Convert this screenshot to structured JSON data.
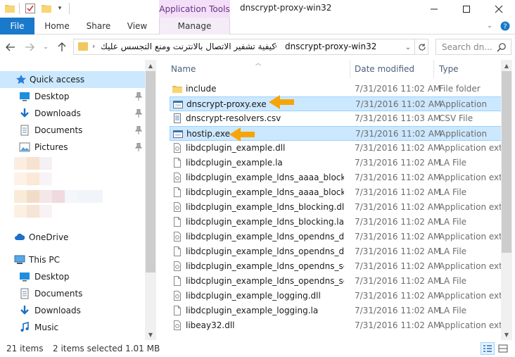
{
  "window": {
    "title": "dnscrypt-proxy-win32",
    "context_tab": "Application Tools"
  },
  "ribbon": {
    "tabs": [
      "File",
      "Home",
      "Share",
      "View",
      "Manage"
    ]
  },
  "address": {
    "crumbs": [
      "كيفية تشفير الاتصال بالانترنت ومنع التجسس عليك",
      "dnscrypt-proxy-win32"
    ],
    "search_placeholder": "Search dn..."
  },
  "nav": {
    "quick_access": "Quick access",
    "quick_items": [
      {
        "label": "Desktop",
        "icon": "desktop-icon",
        "pinned": true
      },
      {
        "label": "Downloads",
        "icon": "downloads-icon",
        "pinned": true
      },
      {
        "label": "Documents",
        "icon": "documents-icon",
        "pinned": true
      },
      {
        "label": "Pictures",
        "icon": "pictures-icon",
        "pinned": true
      }
    ],
    "onedrive": "OneDrive",
    "this_pc": "This PC",
    "pc_items": [
      {
        "label": "Desktop",
        "icon": "desktop-icon"
      },
      {
        "label": "Documents",
        "icon": "documents-icon"
      },
      {
        "label": "Downloads",
        "icon": "downloads-icon"
      },
      {
        "label": "Music",
        "icon": "music-icon"
      }
    ]
  },
  "columns": {
    "name": "Name",
    "date": "Date modified",
    "type": "Type"
  },
  "files": [
    {
      "name": "include",
      "date": "7/31/2016 11:02 AM",
      "type": "File folder",
      "icon": "folder-icon",
      "selected": false
    },
    {
      "name": "dnscrypt-proxy.exe",
      "date": "7/31/2016 11:02 AM",
      "type": "Application",
      "icon": "exe-icon",
      "selected": true
    },
    {
      "name": "dnscrypt-resolvers.csv",
      "date": "7/31/2016 11:03 AM",
      "type": "CSV File",
      "icon": "csv-icon",
      "selected": false
    },
    {
      "name": "hostip.exe",
      "date": "7/31/2016 11:02 AM",
      "type": "Application",
      "icon": "exe-icon",
      "selected": true
    },
    {
      "name": "libdcplugin_example.dll",
      "date": "7/31/2016 11:02 AM",
      "type": "Application exten",
      "icon": "dll-icon",
      "selected": false
    },
    {
      "name": "libdcplugin_example.la",
      "date": "7/31/2016 11:02 AM",
      "type": "LA File",
      "icon": "file-icon",
      "selected": false
    },
    {
      "name": "libdcplugin_example_ldns_aaaa_blocking....",
      "date": "7/31/2016 11:02 AM",
      "type": "Application exten",
      "icon": "dll-icon",
      "selected": false
    },
    {
      "name": "libdcplugin_example_ldns_aaaa_blocking....",
      "date": "7/31/2016 11:02 AM",
      "type": "LA File",
      "icon": "file-icon",
      "selected": false
    },
    {
      "name": "libdcplugin_example_ldns_blocking.dll",
      "date": "7/31/2016 11:02 AM",
      "type": "Application exten",
      "icon": "dll-icon",
      "selected": false
    },
    {
      "name": "libdcplugin_example_ldns_blocking.la",
      "date": "7/31/2016 11:02 AM",
      "type": "LA File",
      "icon": "file-icon",
      "selected": false
    },
    {
      "name": "libdcplugin_example_ldns_opendns_devi...",
      "date": "7/31/2016 11:02 AM",
      "type": "Application exten",
      "icon": "dll-icon",
      "selected": false
    },
    {
      "name": "libdcplugin_example_ldns_opendns_devi...",
      "date": "7/31/2016 11:02 AM",
      "type": "LA File",
      "icon": "file-icon",
      "selected": false
    },
    {
      "name": "libdcplugin_example_ldns_opendns_set_...",
      "date": "7/31/2016 11:02 AM",
      "type": "Application exten",
      "icon": "dll-icon",
      "selected": false
    },
    {
      "name": "libdcplugin_example_ldns_opendns_set_...",
      "date": "7/31/2016 11:02 AM",
      "type": "LA File",
      "icon": "file-icon",
      "selected": false
    },
    {
      "name": "libdcplugin_example_logging.dll",
      "date": "7/31/2016 11:02 AM",
      "type": "Application exten",
      "icon": "dll-icon",
      "selected": false
    },
    {
      "name": "libdcplugin_example_logging.la",
      "date": "7/31/2016 11:02 AM",
      "type": "LA File",
      "icon": "file-icon",
      "selected": false
    },
    {
      "name": "libeay32.dll",
      "date": "7/31/2016 11:02 AM",
      "type": "Application exten",
      "icon": "dll-icon",
      "selected": false
    }
  ],
  "status": {
    "count": "21 items",
    "selection": "2 items selected  1.01 MB"
  },
  "colors": {
    "file_tab": "#1979ca",
    "selection": "#cce8ff",
    "selection_border": "#99d1ff",
    "arrow": "#f5a50a",
    "context_tab_bg": "#f3e0f8"
  }
}
